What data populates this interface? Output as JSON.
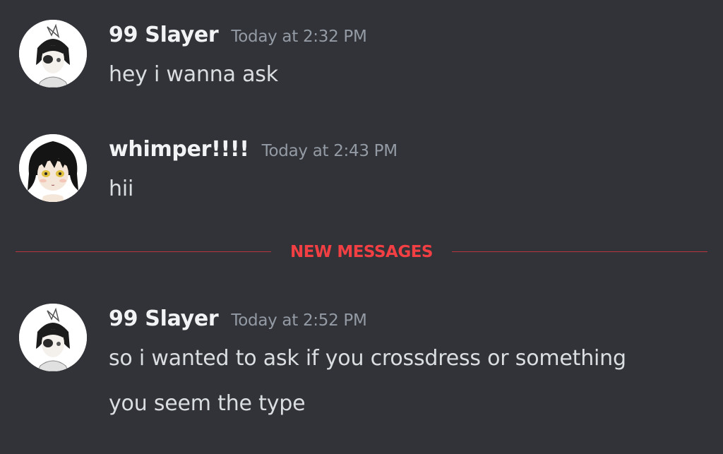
{
  "messages": [
    {
      "username": "99 Slayer",
      "timestamp": "Today at 2:32 PM",
      "lines": [
        "hey i wanna ask"
      ]
    },
    {
      "username": "whimper!!!!",
      "timestamp": "Today at 2:43 PM",
      "lines": [
        "hii"
      ]
    },
    {
      "username": "99 Slayer",
      "timestamp": "Today at 2:52 PM",
      "lines": [
        "so i wanted to ask if you crossdress or something",
        "you seem the type"
      ]
    }
  ],
  "divider": {
    "label": "NEW MESSAGES"
  },
  "colors": {
    "background": "#313338",
    "username": "#f2f3f5",
    "timestamp": "#949ba4",
    "message_text": "#dbdee1",
    "new_messages": "#f23f43"
  }
}
